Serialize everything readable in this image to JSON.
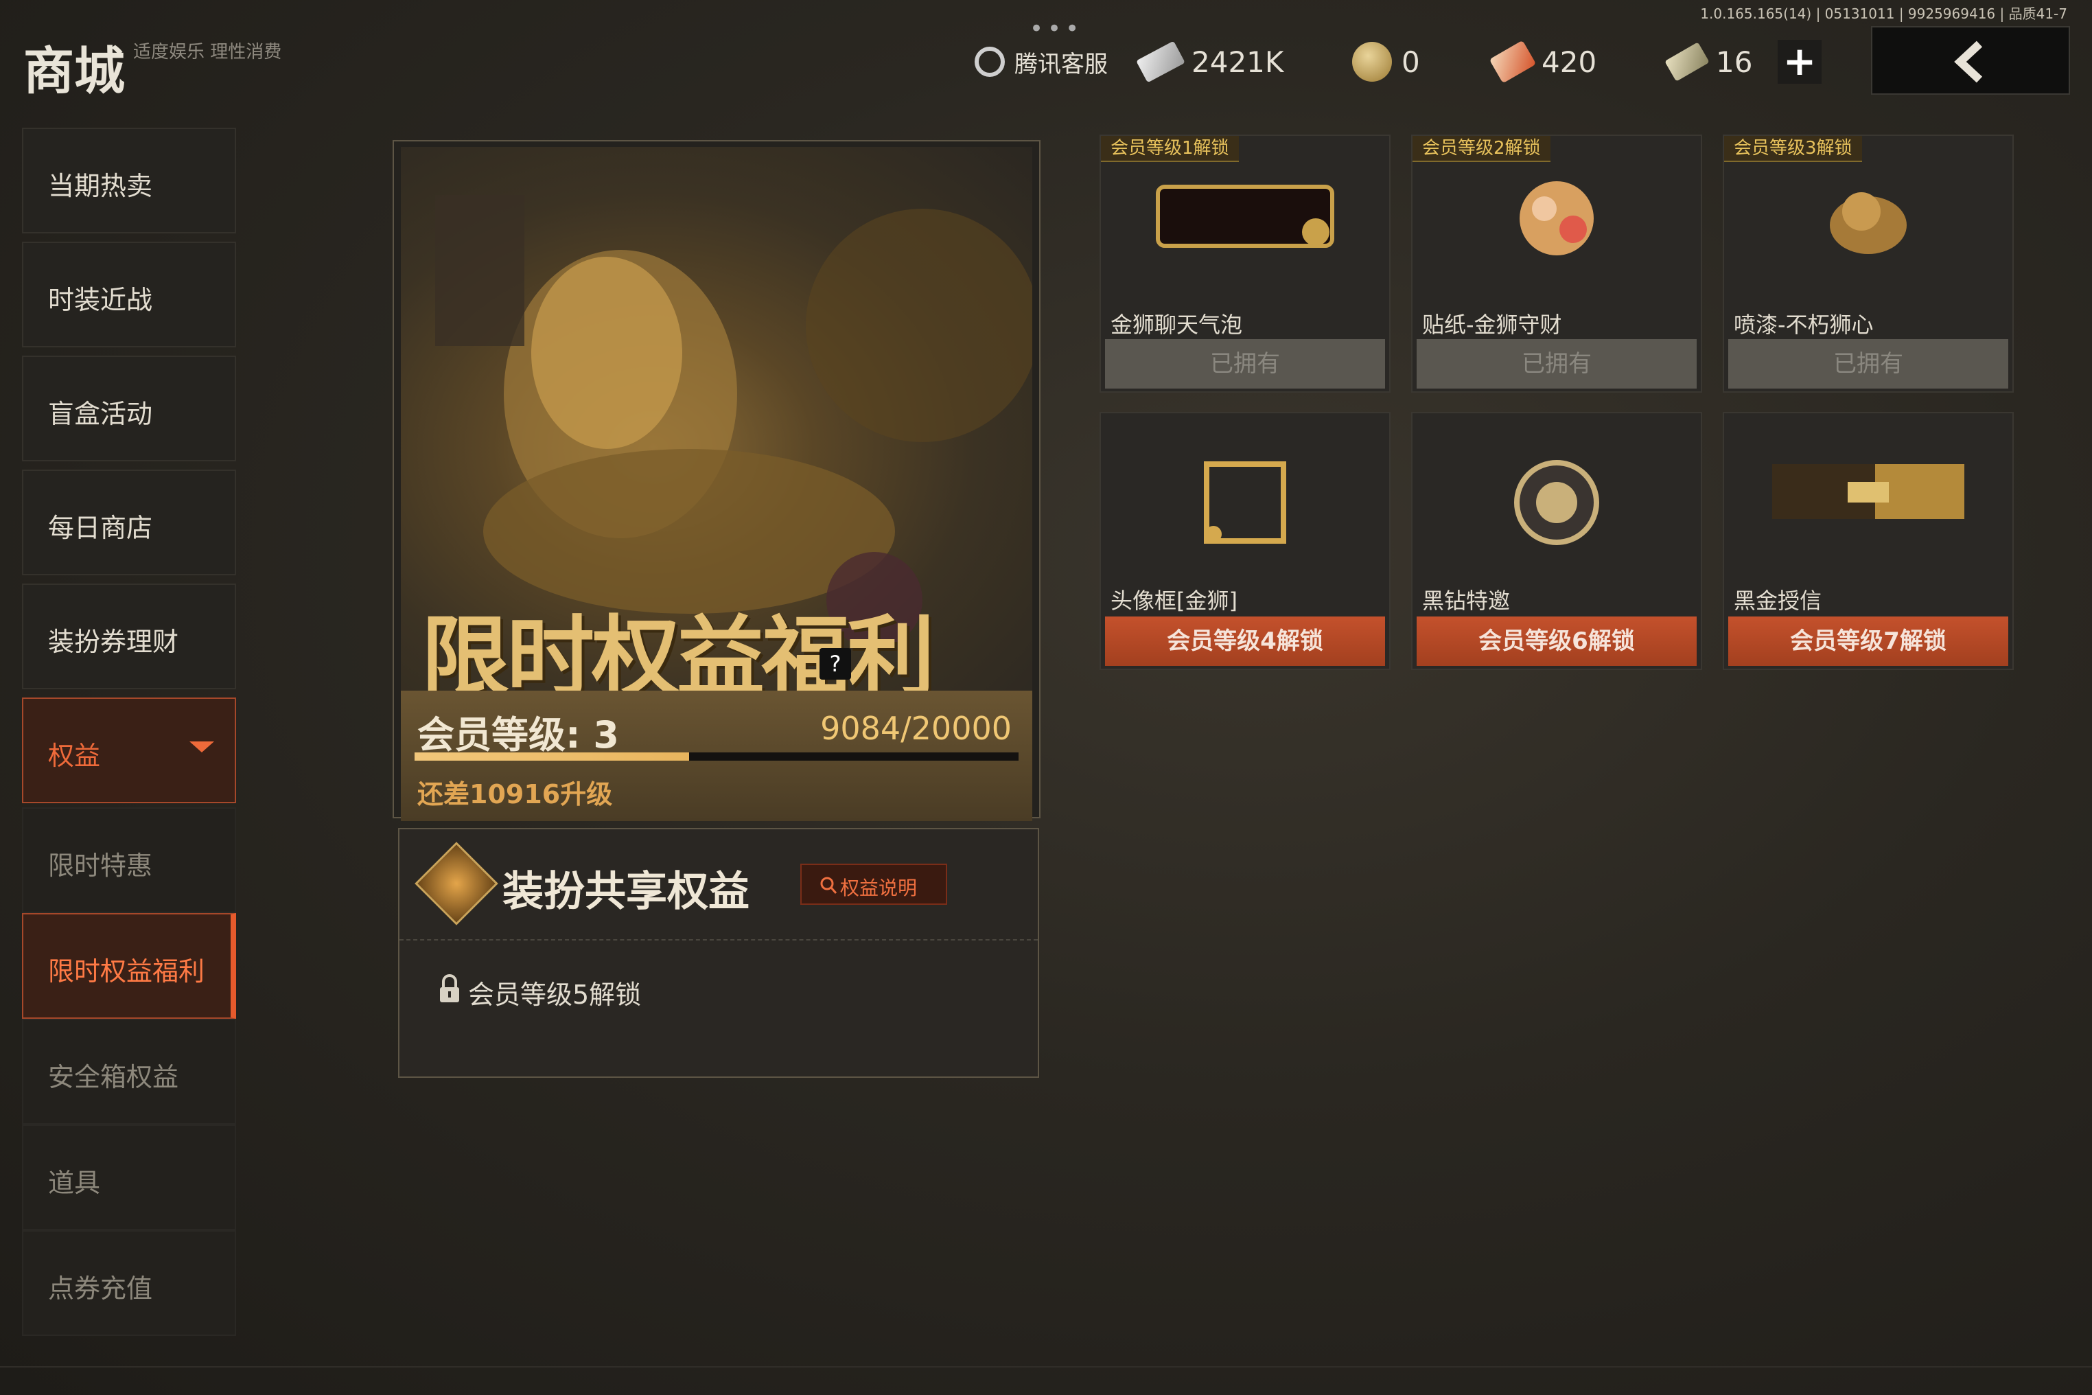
{
  "header": {
    "version": "1.0.165.165(14) | 05131011 | 9925969416 | 品质41-7",
    "title": "商城",
    "slogan": "适度娱乐 理性消费",
    "customer_service": "腾讯客服",
    "resources": [
      {
        "icon": "cash-bill-icon",
        "value": "2421K"
      },
      {
        "icon": "coin-icon",
        "value": "0"
      },
      {
        "icon": "ticket-icon",
        "value": "420"
      },
      {
        "icon": "voucher-icon",
        "value": "16"
      }
    ]
  },
  "sidebar": {
    "items": [
      {
        "label": "当期热卖"
      },
      {
        "label": "时装近战"
      },
      {
        "label": "盲盒活动"
      },
      {
        "label": "每日商店"
      },
      {
        "label": "装扮券理财"
      },
      {
        "label": "权益"
      }
    ],
    "sub_items": [
      {
        "label": "限时特惠"
      },
      {
        "label": "限时权益福利"
      },
      {
        "label": "安全箱权益"
      },
      {
        "label": "道具"
      },
      {
        "label": "点券充值"
      }
    ]
  },
  "banner": {
    "title": "限时权益福利",
    "help": "?",
    "level_label": "会员等级: 3",
    "points": "9084/20000",
    "progress": 0.4542,
    "gap_text": "还差10916升级"
  },
  "share": {
    "title": "装扮共享权益",
    "help_label": "权益说明",
    "lock_text": "会员等级5解锁"
  },
  "rewards": [
    {
      "tag": "会员等级1解锁",
      "name": "金狮聊天气泡",
      "button": "已拥有",
      "state": "owned"
    },
    {
      "tag": "会员等级2解锁",
      "name": "贴纸-金狮守财",
      "button": "已拥有",
      "state": "owned"
    },
    {
      "tag": "会员等级3解锁",
      "name": "喷漆-不朽狮心",
      "button": "已拥有",
      "state": "owned"
    },
    {
      "tag": "",
      "name": "头像框[金狮]",
      "button": "会员等级4解锁",
      "state": "locked"
    },
    {
      "tag": "",
      "name": "黑钻特邀",
      "button": "会员等级6解锁",
      "state": "locked"
    },
    {
      "tag": "",
      "name": "黑金授信",
      "button": "会员等级7解锁",
      "state": "locked"
    }
  ],
  "colors": {
    "accent": "#e65a2c",
    "gold": "#e4bf73",
    "owned": "#5a5750"
  }
}
